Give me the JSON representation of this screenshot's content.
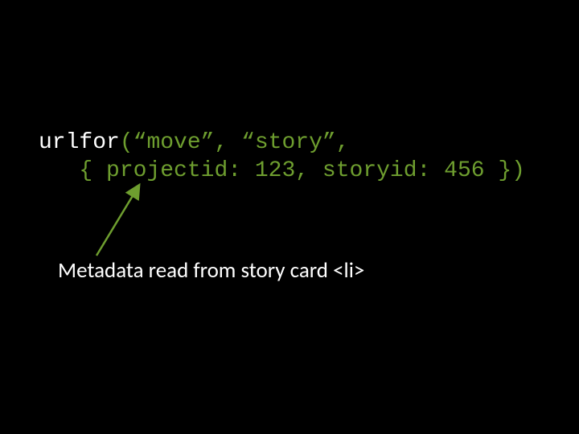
{
  "code": {
    "fn": "urlfor",
    "open_paren": "(",
    "arg1": "“move”",
    "comma1": ", ",
    "arg2": "“story”",
    "comma2": ",",
    "indent": "   ",
    "brace_open": "{ ",
    "key1": "projectid: ",
    "val1": "123",
    "comma3": ", ",
    "key2": "storyid: ",
    "val2": "456",
    "brace_close": " }",
    "close_paren": ")"
  },
  "caption": "Metadata read from story card <li>"
}
